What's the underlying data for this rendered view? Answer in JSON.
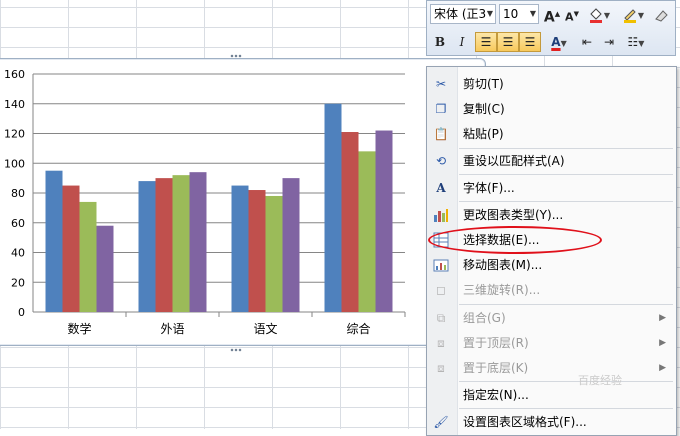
{
  "mini_toolbar": {
    "font_name": "宋体 (正3",
    "font_size": "10",
    "grow_font": "A",
    "shrink_font": "A",
    "bold": "B",
    "italic": "I",
    "font_color": "A"
  },
  "context_menu": {
    "items": [
      {
        "label": "剪切(T)",
        "icon": "scissors-icon",
        "enabled": true
      },
      {
        "label": "复制(C)",
        "icon": "copy-icon",
        "enabled": true
      },
      {
        "label": "粘贴(P)",
        "icon": "paste-icon",
        "enabled": true
      },
      {
        "label": "重设以匹配样式(A)",
        "icon": "reset-style-icon",
        "enabled": true
      },
      {
        "label": "字体(F)...",
        "icon": "font-icon",
        "enabled": true
      },
      {
        "label": "更改图表类型(Y)...",
        "icon": "chart-type-icon",
        "enabled": true
      },
      {
        "label": "选择数据(E)...",
        "icon": "select-data-icon",
        "enabled": true
      },
      {
        "label": "移动图表(M)...",
        "icon": "move-chart-icon",
        "enabled": true
      },
      {
        "label": "三维旋转(R)...",
        "icon": "3d-rotate-icon",
        "enabled": false
      },
      {
        "label": "组合(G)",
        "icon": "group-icon",
        "enabled": false
      },
      {
        "label": "置于顶层(R)",
        "icon": "bring-to-front-icon",
        "enabled": false
      },
      {
        "label": "置于底层(K)",
        "icon": "send-to-back-icon",
        "enabled": false
      },
      {
        "label": "指定宏(N)...",
        "icon": "macro-icon",
        "enabled": true
      },
      {
        "label": "设置图表区域格式(F)...",
        "icon": "format-chart-area-icon",
        "enabled": true
      }
    ]
  },
  "watermark": "百度经验",
  "colors": {
    "series1": "#4f81bd",
    "series2": "#c0504d",
    "series3": "#9bbb59",
    "series4": "#8064a2",
    "highlight": "#e0101a"
  },
  "chart_data": {
    "type": "bar",
    "categories": [
      "数学",
      "外语",
      "语文",
      "综合"
    ],
    "series": [
      {
        "values": [
          95,
          88,
          85,
          140
        ]
      },
      {
        "values": [
          85,
          90,
          82,
          121
        ]
      },
      {
        "values": [
          74,
          92,
          78,
          108
        ]
      },
      {
        "values": [
          58,
          94,
          90,
          122
        ]
      }
    ],
    "ylim": [
      0,
      160
    ],
    "yticks": [
      "0",
      "20",
      "40",
      "60",
      "80",
      "100",
      "120",
      "140",
      "160"
    ],
    "grid": true,
    "legend": "hidden"
  }
}
